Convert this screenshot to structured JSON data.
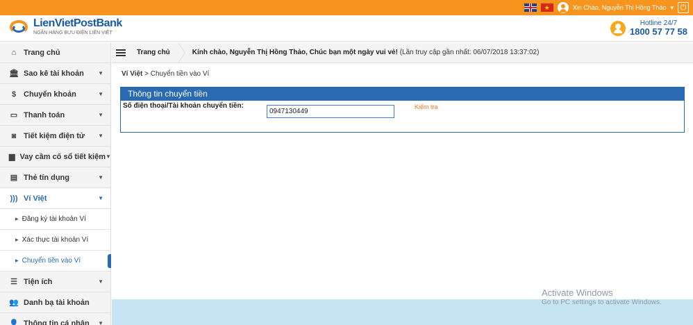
{
  "topbar": {
    "flag_en": "English",
    "flag_vn": "★",
    "greeting": "Xin Chào, Nguyễn Thị Hồng Thảo",
    "dropdown": "▾",
    "logout": "⏻"
  },
  "header": {
    "logo_main": "LienVietPostBank",
    "logo_sub": "NGÂN HÀNG BƯU ĐIỆN LIÊN VIỆT",
    "hotline_label": "Hotline 24/7",
    "hotline_number": "1800 57 77 58"
  },
  "sidebar": {
    "items": [
      {
        "label": "Trang chủ",
        "icon": "home-icon",
        "glyph": "⌂",
        "chevron": ""
      },
      {
        "label": "Sao kê tài khoản",
        "icon": "bank-icon",
        "glyph": "🏛",
        "chevron": "▼"
      },
      {
        "label": "Chuyển khoản",
        "icon": "dollar-icon",
        "glyph": "$",
        "chevron": "▼"
      },
      {
        "label": "Thanh toán",
        "icon": "card-icon",
        "glyph": "▭",
        "chevron": "▼"
      },
      {
        "label": "Tiết kiệm điện tử",
        "icon": "money-icon",
        "glyph": "◙",
        "chevron": "▼"
      },
      {
        "label": "Vay cầm cố sổ tiết kiệm",
        "icon": "loan-icon",
        "glyph": "▆",
        "chevron": "▼"
      },
      {
        "label": "Thẻ tín dụng",
        "icon": "credit-card-icon",
        "glyph": "▤",
        "chevron": "▼"
      },
      {
        "label": "Ví Việt",
        "icon": "wallet-signal-icon",
        "glyph": ")))",
        "chevron": "▼"
      }
    ],
    "sub_items": [
      {
        "label": "Đăng ký tài khoản Ví"
      },
      {
        "label": "Xác thực tài khoản Ví"
      },
      {
        "label": "Chuyển tiền vào Ví"
      }
    ],
    "items_after": [
      {
        "label": "Tiện ích",
        "icon": "list-icon",
        "glyph": "☰",
        "chevron": "▼"
      },
      {
        "label": "Danh bạ tài khoản",
        "icon": "contacts-icon",
        "glyph": "👥",
        "chevron": ""
      },
      {
        "label": "Thông tin cá nhân",
        "icon": "person-icon",
        "glyph": "👤",
        "chevron": "▼"
      }
    ],
    "sub_bullet": "▶"
  },
  "crumbbar": {
    "home": "Trang chủ",
    "welcome": "Kính chào, Nguyễn Thị Hồng Thảo, Chúc bạn một ngày vui vẻ!",
    "last_access": "(Lần truy cập gần nhất: 06/07/2018 13:37:02)"
  },
  "content": {
    "path_root": "Ví Việt",
    "path_sep": " > ",
    "path_current": "Chuyển tiền vào Ví",
    "panel_title": "Thông tin chuyển tiền",
    "field_label": "Số điện thoại/Tài khoản chuyển tiền:",
    "field_value": "0947130449",
    "check_label": "Kiểm tra"
  },
  "watermark": {
    "title": "Activate Windows",
    "subtitle": "Go to PC settings to activate Windows."
  },
  "colors": {
    "orange": "#f7941d",
    "blue": "#2a6ab2",
    "light_blue": "#c7e4f5"
  }
}
